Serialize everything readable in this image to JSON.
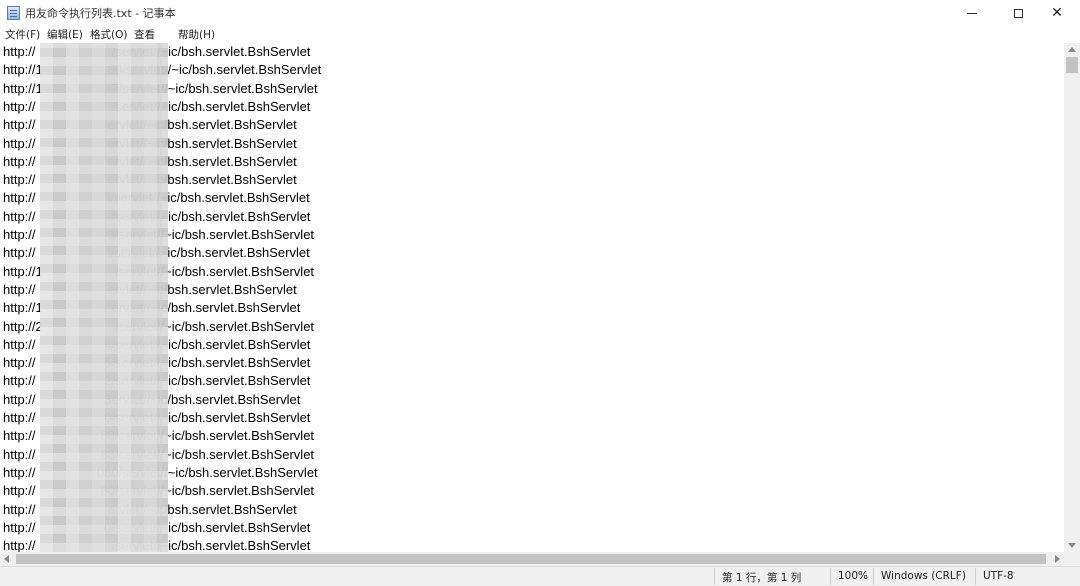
{
  "window": {
    "title": "用友命令执行列表.txt - 记事本"
  },
  "menu": [
    "文件(F)",
    "编辑(E)",
    "格式(O)",
    "查看",
    "帮助(H)"
  ],
  "lines": [
    "http://                     /servlet//~ic/bsh.servlet.BshServlet",
    "http://1                  80/servlet//~ic/bsh.servlet.BshServlet",
    "http://1                   7/servlet//~ic/bsh.servlet.BshServlet",
    "http://                     /servlet//~ic/bsh.servlet.BshServlet",
    "http://                    ervlet//~ic/bsh.servlet.BshServlet",
    "http://                    ervlet//~ic/bsh.servlet.BshServlet",
    "http://                    ervlet//~ic/bsh.servlet.BshServlet",
    "http://                    ervlet//~ic/bsh.servlet.BshServlet",
    "http://                    l/servlet//~ic/bsh.servlet.BshServlet",
    "http://                     /servlet//~ic/bsh.servlet.BshServlet",
    "http://                    3/servlet//~ic/bsh.servlet.BshServlet",
    "http://                    l/servlet//~ic/bsh.servlet.BshServlet",
    "http://1                    /servlet//~ic/bsh.servlet.BshServlet",
    "http://                    ervlet//~ic/bsh.servlet.BshServlet",
    "http://1                   ervlet//~ic/bsh.servlet.BshServlet",
    "http://2                    /servlet//~ic/bsh.servlet.BshServlet",
    "http://                   4/servlet//~ic/bsh.servlet.BshServlet",
    "http://                   5/servlet//~ic/bsh.servlet.BshServlet",
    "http://                   2/servlet//~ic/bsh.servlet.BshServlet",
    "http://                   3ervlet//~ic/bsh.servlet.BshServlet",
    "http://                   0/servlet//~ic/bsh.servlet.BshServlet",
    "http://                  88/servlet//~ic/bsh.servlet.BshServlet",
    "http://                  88/servlet//~ic/bsh.servlet.BshServlet",
    "http://                 080/servlet//~ic/bsh.servlet.BshServlet",
    "http://                  80/servlet//~ic/bsh.servlet.BshServlet",
    "http://                    ervlet//~ic/bsh.servlet.BshServlet",
    "http://                   0/servlet//~ic/bsh.servlet.BshServlet",
    "http://                     /servlet//~ic/bsh.servlet.BshServlet"
  ],
  "status": {
    "position": "第 1 行，第 1 列",
    "zoom": "100%",
    "line_ending": "Windows (CRLF)",
    "encoding": "UTF-8"
  }
}
